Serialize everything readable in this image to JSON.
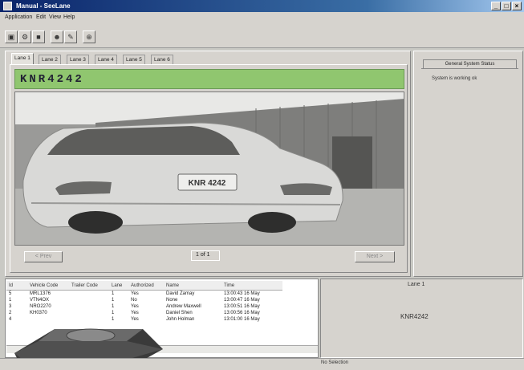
{
  "window": {
    "title": "Manual - SeeLane"
  },
  "menu": [
    "Application",
    "Edit",
    "View",
    "Help"
  ],
  "tabs": [
    "Lane 1",
    "Lane 2",
    "Lane 3",
    "Lane 4",
    "Lane 5",
    "Lane 6"
  ],
  "plate": {
    "banner_text": "KNR4242"
  },
  "camera": {
    "plate_text": "KNR 4242"
  },
  "paging": {
    "prev_label": "< Prev",
    "next_label": "Next >",
    "page_text": "1 of 1"
  },
  "status_panel": {
    "tab_label": "General System Status",
    "message": "System is working ok"
  },
  "log": {
    "columns": [
      "Id",
      "Vehicle Code",
      "Trailer Code",
      "Lane",
      "Authorized",
      "Name",
      "Time"
    ],
    "rows": [
      [
        "5",
        "MRL1376",
        "",
        "1",
        "Yes",
        "David Zamay",
        "13:00:43 16 May"
      ],
      [
        "1",
        "VTN4OX",
        "",
        "1",
        "No",
        "None",
        "13:00:47 16 May"
      ],
      [
        "3",
        "NRO2270",
        "",
        "1",
        "Yes",
        "Andrew Maxwell",
        "13:00:51 16 May"
      ],
      [
        "2",
        "KH0370",
        "",
        "1",
        "Yes",
        "Daniel Shen",
        "13:00:56 16 May"
      ],
      [
        "4",
        "",
        "",
        "1",
        "Yes",
        "John Holman",
        "13:01:00 16 May"
      ]
    ]
  },
  "detail": {
    "lane_label": "Lane 1",
    "plate": "KNR4242"
  },
  "statusbar": {
    "text": "No Selection"
  },
  "colors": {
    "plate_banner": "#90c66f",
    "titlebar": "#0a246a"
  }
}
